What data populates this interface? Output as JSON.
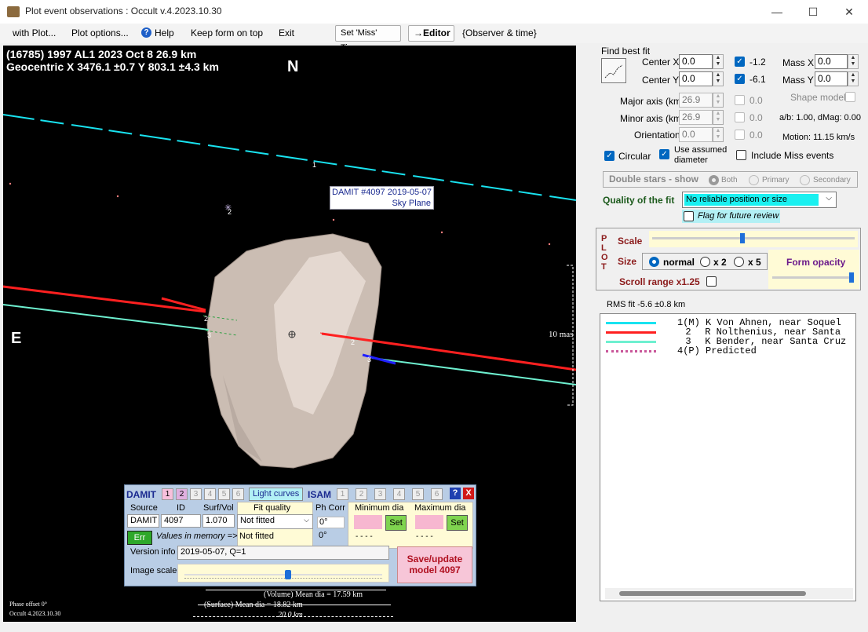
{
  "window": {
    "title": "Plot event observations : Occult v.4.2023.10.30",
    "minimize": "—",
    "maximize": "☐",
    "close": "✕"
  },
  "menu": {
    "with_plot": "with Plot...",
    "plot_options": "Plot options...",
    "help": "Help",
    "keep_form": "Keep form on top",
    "exit": "Exit",
    "set_miss_times": "Set 'Miss' Times",
    "editor": "→Editor",
    "observer_time": "{Observer & time}"
  },
  "plot": {
    "header_line1": "(16785) 1997 AL1  2023 Oct 8   26.9 km",
    "header_line2": "Geocentric  X  3476.1 ±0.7  Y 803.1 ±4.3 km",
    "north": "N",
    "east": "E",
    "damit_label_1": "DAMIT #4097 2019-05-07",
    "damit_label_2": "Sky Plane",
    "scale_mas": "10 mas",
    "volume_dia": "(Volume) Mean dia = 17.59 km",
    "surface_dia": "(Surface) Mean dia = 18.82 km",
    "scale_km": "20.0  km",
    "phase_offset": "Phase offset 0°",
    "version": "Occult 4.2023.10.30",
    "chord_labels": [
      "1",
      "2",
      "3",
      "2",
      "3",
      "2"
    ]
  },
  "fit": {
    "find_best_fit": "Find best fit",
    "center_x_label": "Center X",
    "center_x": "0.0",
    "center_y_label": "Center Y",
    "center_y": "0.0",
    "cx_check_value": "-1.2",
    "cy_check_value": "-6.1",
    "mass_x_label": "Mass X",
    "mass_x": "0.0",
    "mass_y_label": "Mass Y",
    "mass_y": "0.0",
    "major_label": "Major axis (km)",
    "major": "26.9",
    "major_chk": "0.0",
    "minor_label": "Minor axis (km)",
    "minor": "26.9",
    "minor_chk": "0.0",
    "orient_label": "Orientation",
    "orient": "0.0",
    "orient_chk": "0.0",
    "shape_model": "Shape model",
    "ab_dmag": "a/b: 1.00, dMag: 0.00",
    "motion": "Motion: 11.15 km/s",
    "circular": "Circular",
    "use_assumed": "Use assumed",
    "diameter": "diameter",
    "include_miss": "Include Miss events",
    "double_stars": "Double stars - show",
    "both": "Both",
    "primary": "Primary",
    "secondary": "Secondary",
    "quality_label": "Quality of the fit",
    "quality_value": "No reliable position or size",
    "flag_review": "Flag for future review"
  },
  "plotctl": {
    "plot_letters": [
      "P",
      "L",
      "O",
      "T"
    ],
    "scale": "Scale",
    "size": "Size",
    "normal": "normal",
    "x2": "x 2",
    "x5": "x 5",
    "form_opacity": "Form opacity",
    "scroll_range": "Scroll range x1.25",
    "rms_fit": "RMS fit -5.6 ±0.8 km"
  },
  "legend": [
    {
      "num": "1(M)",
      "text": "K Von Ahnen, near Soquel",
      "color": "#19e3f0",
      "style": "solid"
    },
    {
      "num": "2",
      "text": "R Nolthenius, near Santa",
      "color": "#ff2020",
      "style": "solid"
    },
    {
      "num": "3",
      "text": "K Bender, near Santa Cruz",
      "color": "#6ef0d0",
      "style": "solid"
    },
    {
      "num": "4(P)",
      "text": "Predicted",
      "color": "#c9569a",
      "style": "dotted"
    }
  ],
  "damit": {
    "damit": "DAMIT",
    "tabs": [
      "1",
      "2",
      "3",
      "4",
      "5",
      "6"
    ],
    "light_curves": "Light curves",
    "isam": "ISAM",
    "isam_tabs": [
      "1",
      "2",
      "3",
      "4",
      "5",
      "6"
    ],
    "help_q": "?",
    "close_x": "X",
    "source_hdr": "Source",
    "id_hdr": "ID",
    "surfvol_hdr": "Surf/Vol",
    "fitq_hdr": "Fit quality",
    "phcorr_hdr": "Ph Corr",
    "mindia_hdr": "Minimum dia",
    "maxdia_hdr": "Maximum dia",
    "source": "DAMIT",
    "id": "4097",
    "surfvol": "1.070",
    "fit_quality": "Not fitted",
    "ph_corr": "0°",
    "set": "Set",
    "err": "Err",
    "values_memory": "Values in memory =>",
    "fit_quality_mem": "Not fitted",
    "ph_corr_mem": "0°",
    "min_mem": "- - - -",
    "max_mem": "- - - -",
    "version_info_label": "Version info",
    "version_info": "2019-05-07, Q=1",
    "image_scale_label": "Image scale",
    "save_update": "Save/update",
    "model_id": "model 4097"
  }
}
